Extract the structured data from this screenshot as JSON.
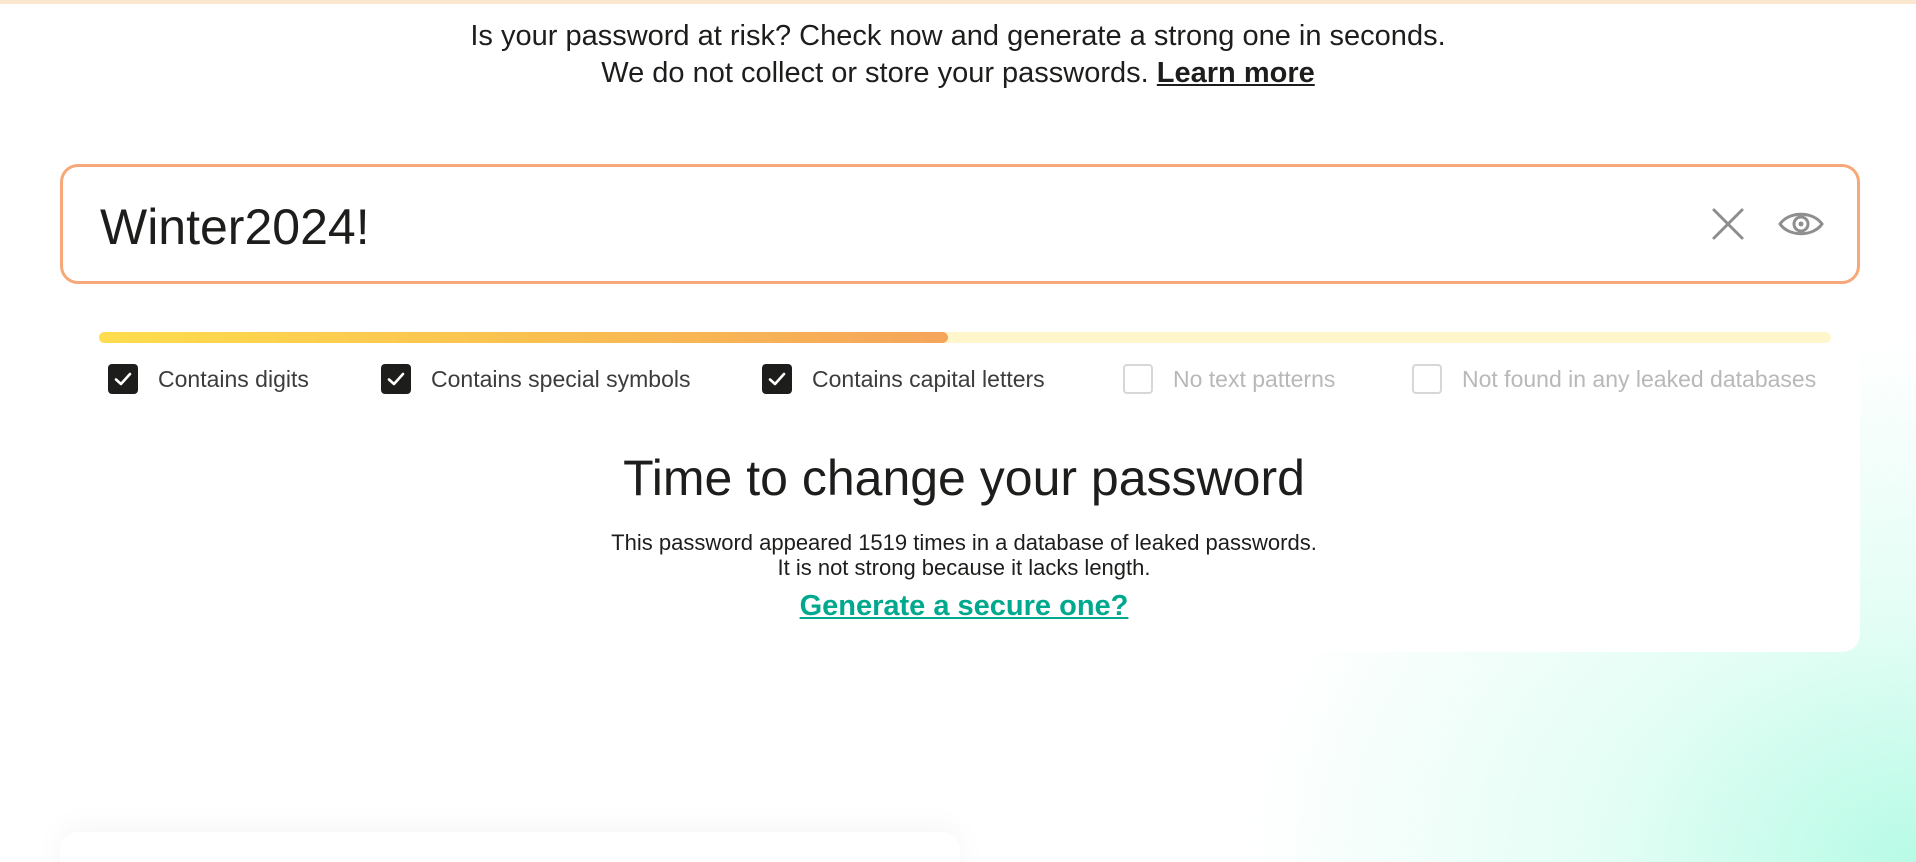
{
  "intro": {
    "line1": "Is your password at risk? Check now and generate a strong one in seconds.",
    "line2": "We do not collect or store your passwords.",
    "learn_more": "Learn more"
  },
  "password": {
    "value": "Winter2024!",
    "border_color": "#f7a878"
  },
  "strength": {
    "fill_fraction": 0.49,
    "colors": [
      "#ffdd4d",
      "#f6a55a"
    ]
  },
  "checks": [
    {
      "label": "Contains digits",
      "checked": true
    },
    {
      "label": "Contains special symbols",
      "checked": true
    },
    {
      "label": "Contains capital letters",
      "checked": true
    },
    {
      "label": "No text patterns",
      "checked": false
    },
    {
      "label": "Not found in any leaked databases",
      "checked": false
    }
  ],
  "result": {
    "title": "Time to change your password",
    "detail_line1": "This password appeared 1519 times in a database of leaked passwords.",
    "detail_line2": "It is not strong because it lacks length.",
    "generate_link": "Generate a secure one?",
    "link_color": "#00a88e"
  },
  "icons": {
    "clear": "close-icon",
    "reveal": "eye-icon",
    "check": "checkmark-icon"
  }
}
